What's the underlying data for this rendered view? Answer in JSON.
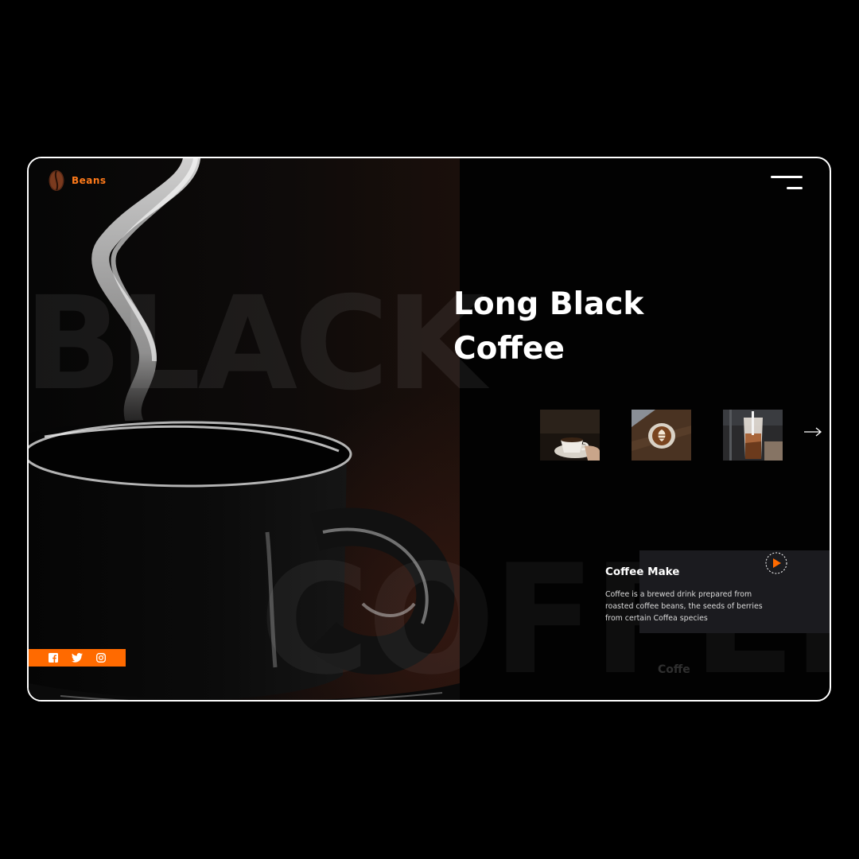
{
  "brand": {
    "name": "Beans",
    "logo_icon": "coffee-bean-icon",
    "accent": "#ff6a00"
  },
  "header": {
    "menu_icon": "hamburger-menu-icon"
  },
  "background_words": {
    "top": "BLACK",
    "bottom": "COFFEE",
    "small": "Coffe"
  },
  "hero": {
    "title_line1": "Long Black",
    "title_line2": "Coffee"
  },
  "gallery": {
    "thumbnails": [
      {
        "name": "coffee-cup-on-saucer"
      },
      {
        "name": "latte-art"
      },
      {
        "name": "iced-coffee-glass"
      }
    ],
    "next_icon": "arrow-right-icon"
  },
  "info_card": {
    "title": "Coffee Make",
    "text": "Coffee is a brewed drink prepared from roasted coffee beans, the seeds of berries from certain Coffea species",
    "play_icon": "play-icon"
  },
  "social": {
    "icons": [
      "facebook-icon",
      "twitter-icon",
      "instagram-icon"
    ]
  }
}
